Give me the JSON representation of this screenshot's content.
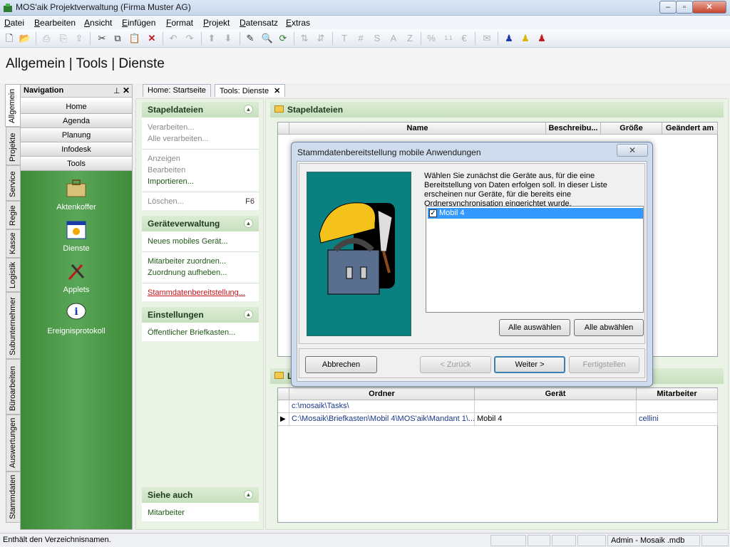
{
  "window": {
    "title": "MOS'aik Projektverwaltung (Firma Muster AG)"
  },
  "menu": [
    "Datei",
    "Bearbeiten",
    "Ansicht",
    "Einfügen",
    "Format",
    "Projekt",
    "Datensatz",
    "Extras"
  ],
  "header": {
    "title": "Allgemein | Tools | Dienste"
  },
  "vtabs": [
    "Allgemein",
    "Projekte",
    "Service",
    "Regie",
    "Kasse",
    "Logistik",
    "Subunternehmer",
    "Büroarbeiten",
    "Auswertungen",
    "Stammdaten"
  ],
  "navigation": {
    "title": "Navigation",
    "buttons": [
      "Home",
      "Agenda",
      "Planung",
      "Infodesk",
      "Tools"
    ],
    "apps": [
      "Aktenkoffer",
      "Dienste",
      "Applets",
      "Ereignisprotokoll"
    ]
  },
  "doc_tabs": [
    "Home: Startseite",
    "Tools: Dienste"
  ],
  "taskpane": {
    "stapel": {
      "title": "Stapeldateien",
      "items": [
        "Verarbeiten...",
        "Alle verarbeiten...",
        "Anzeigen",
        "Bearbeiten",
        "Importieren...",
        "Löschen..."
      ],
      "shortcut": "F6"
    },
    "geraete": {
      "title": "Geräteverwaltung",
      "items": [
        "Neues mobiles Gerät...",
        "Mitarbeiter zuordnen...",
        "Zuordnung aufheben...",
        "Stammdatenbereitstellung..."
      ]
    },
    "einstellungen": {
      "title": "Einstellungen",
      "items": [
        "Öffentlicher Briefkasten..."
      ]
    },
    "siehe": {
      "title": "Siehe auch",
      "items": [
        "Mitarbeiter"
      ]
    }
  },
  "main": {
    "stapel_title": "Stapeldateien",
    "stapel_columns": [
      "Name",
      "Beschreibu...",
      "Größe",
      "Geändert am"
    ],
    "second_title": "L",
    "dir_columns": [
      "Ordner",
      "Gerät",
      "Mitarbeiter"
    ],
    "dir_rows": [
      {
        "ordner": "c:\\mosaik\\Tasks\\",
        "geraet": "",
        "mitarbeiter": ""
      },
      {
        "ordner": "C:\\Mosaik\\Briefkasten\\Mobil 4\\MOS'aik\\Mandant 1\\...",
        "geraet": "Mobil 4",
        "mitarbeiter": "cellini"
      }
    ]
  },
  "dialog": {
    "title": "Stammdatenbereitstellung mobile Anwendungen",
    "description": "Wählen Sie zunächst die Geräte aus, für die eine Bereitstellung von Daten erfolgen soll. In dieser Liste erscheinen nur Geräte, für die bereits eine Ordnersynchronisation eingerichtet wurde.",
    "devices": [
      {
        "label": "Mobil 4",
        "checked": true
      }
    ],
    "select_all": "Alle auswählen",
    "deselect_all": "Alle abwählen",
    "cancel": "Abbrechen",
    "back": "< Zurück",
    "next": "Weiter >",
    "finish": "Fertigstellen"
  },
  "status": {
    "left": "Enthält den Verzeichnisnamen.",
    "right": "Admin - Mosaik .mdb"
  }
}
